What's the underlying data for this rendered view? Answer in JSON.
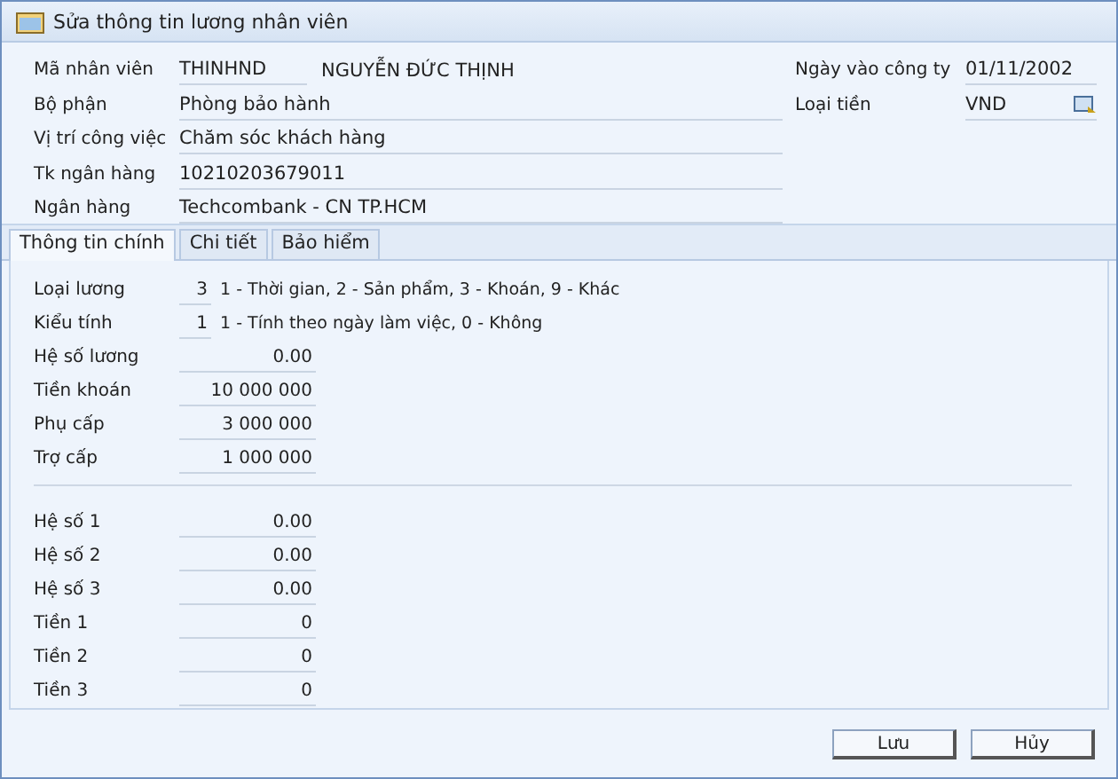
{
  "window": {
    "title": "Sửa thông tin lương nhân viên"
  },
  "employee": {
    "code_label": "Mã nhân viên",
    "code": "THINHND",
    "name": "NGUYỄN ĐỨC THỊNH"
  },
  "fields": [
    {
      "label": "Bộ phận",
      "value": "Phòng bảo hành"
    },
    {
      "label": "Vị trí công việc",
      "value": "Chăm sóc khách hàng"
    },
    {
      "label": "Tk ngân hàng",
      "value": "10210203679011"
    },
    {
      "label": "Ngân hàng",
      "value": "Techcombank - CN TP.HCM"
    }
  ],
  "side_fields": [
    {
      "label": "Ngày vào công ty",
      "value": "01/11/2002",
      "kind": "text"
    },
    {
      "label": "Loại tiền",
      "value": "VND",
      "kind": "lookup"
    }
  ],
  "tabs": [
    {
      "label": "Thông tin chính",
      "selected": true
    },
    {
      "label": "Chi tiết",
      "selected": false
    },
    {
      "label": "Bảo hiểm",
      "selected": false
    }
  ],
  "code_fields": [
    {
      "label": "Loại lương",
      "value": "3",
      "hint": "1 - Thời gian, 2 - Sản phẩm, 3 - Khoán, 9 - Khác"
    },
    {
      "label": "Kiểu tính",
      "value": "1",
      "hint": "1 - Tính theo ngày làm việc, 0 - Không"
    }
  ],
  "amounts": [
    {
      "label": "Hệ số lương",
      "value": "0.00"
    },
    {
      "label": "Tiền khoán",
      "value": "10 000 000"
    },
    {
      "label": "Phụ cấp",
      "value": "3 000 000"
    },
    {
      "label": "Trợ cấp",
      "value": "1 000 000"
    }
  ],
  "extra_amounts": [
    {
      "label": "Hệ số 1",
      "value": "0.00"
    },
    {
      "label": "Hệ số 2",
      "value": "0.00"
    },
    {
      "label": "Hệ số 3",
      "value": "0.00"
    },
    {
      "label": "Tiền 1",
      "value": "0"
    },
    {
      "label": "Tiền 2",
      "value": "0"
    },
    {
      "label": "Tiền 3",
      "value": "0"
    }
  ],
  "buttons": [
    "Lưu",
    "Hủy"
  ]
}
